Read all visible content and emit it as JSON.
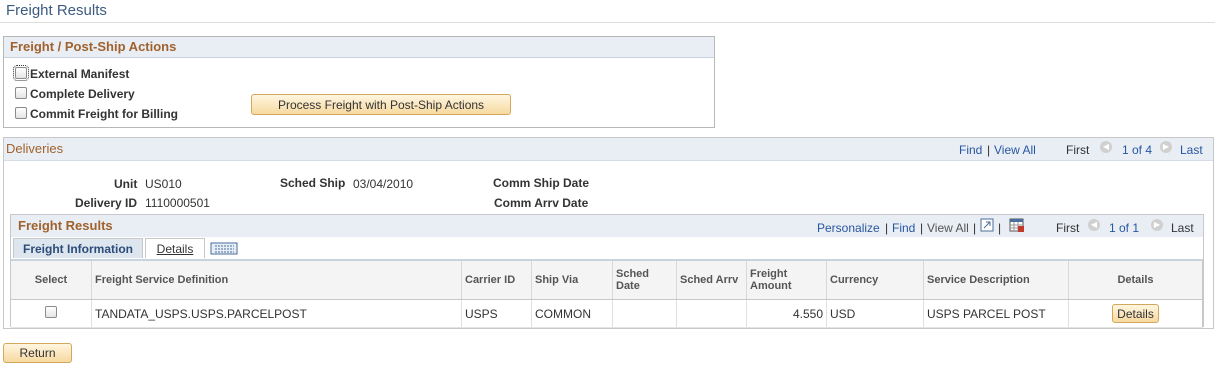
{
  "page": {
    "title": "Freight Results"
  },
  "actions": {
    "title": "Freight / Post-Ship Actions",
    "checkboxes": [
      {
        "label": "External Manifest",
        "checked": false
      },
      {
        "label": "Complete Delivery",
        "checked": false
      },
      {
        "label": "Commit Freight for Billing",
        "checked": false
      }
    ],
    "process_button": "Process Freight with Post-Ship Actions"
  },
  "deliveries": {
    "title": "Deliveries",
    "find": "Find",
    "sep": "|",
    "view_all": "View All",
    "first": "First",
    "range": "1 of 4",
    "last": "Last",
    "fields": {
      "unit_label": "Unit",
      "unit_value": "US010",
      "delivery_id_label": "Delivery ID",
      "delivery_id_value": "1110000501",
      "sched_ship_label": "Sched Ship",
      "sched_ship_value": "03/04/2010",
      "comm_ship_label": "Comm Ship Date",
      "comm_arrv_label": "Comm Arrv Date"
    }
  },
  "freight_results": {
    "title": "Freight Results",
    "personalize": "Personalize",
    "sep": "|",
    "find": "Find",
    "view_all": "View All",
    "first": "First",
    "range": "1 of 1",
    "last": "Last",
    "tabs": [
      "Freight Information",
      "Details"
    ],
    "columns": [
      "Select",
      "Freight Service Definition",
      "Carrier ID",
      "Ship Via",
      "Sched Date",
      "Sched Arrv",
      "Freight Amount",
      "Currency",
      "Service Description",
      "Details"
    ],
    "rows": [
      {
        "freight_service_definition": "TANDATA_USPS.USPS.PARCELPOST",
        "carrier_id": "USPS",
        "ship_via": "COMMON",
        "sched_date": "",
        "sched_arrv": "",
        "freight_amount": "4.550",
        "currency": "USD",
        "service_description": "USPS PARCEL POST",
        "details_button": "Details"
      }
    ]
  },
  "footer": {
    "return_button": "Return"
  },
  "colors": {
    "section_title": "#a0622d",
    "link": "#2856a1",
    "button_bg": "#f7d9a0",
    "header_bg": "#e9eef4"
  },
  "icons": [
    "prev-arrow-icon",
    "next-arrow-icon",
    "zoom-icon",
    "download-grid-icon",
    "show-all-columns-icon"
  ]
}
